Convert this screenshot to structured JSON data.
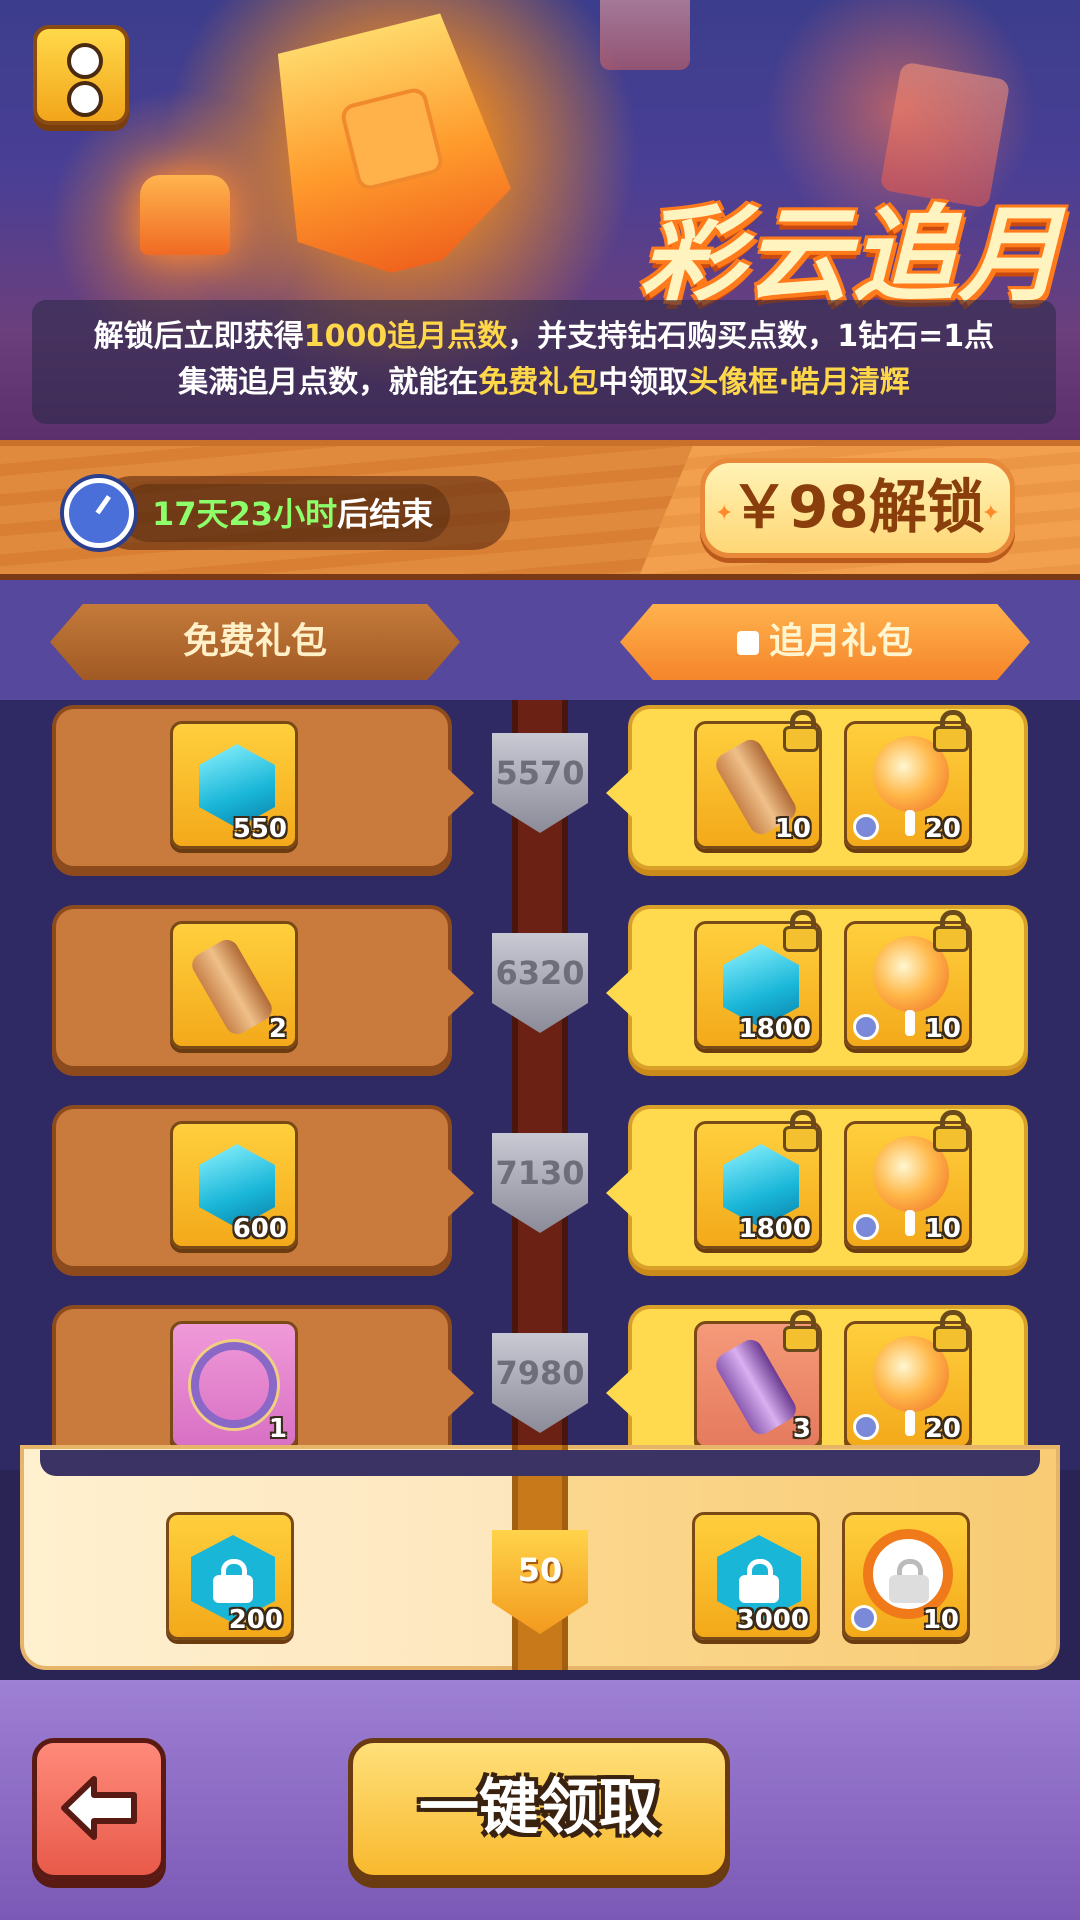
{
  "event": {
    "title": "彩云追月",
    "desc_line1": {
      "a": "解锁后立即获得",
      "b": "1000追月点数",
      "c": "，并支持钻石购买点数，1钻石=1点"
    },
    "desc_line2": {
      "a": "集满追月点数，就能在",
      "b": "免费礼包",
      "c": "中领取",
      "d": "头像框·皓月清辉"
    }
  },
  "timer": {
    "remaining": "17天23小时",
    "suffix": "后结束"
  },
  "unlock_button": {
    "label": "￥98解锁"
  },
  "tabs": {
    "free": "免费礼包",
    "premium": "追月礼包"
  },
  "rows": [
    {
      "points": "5570",
      "free": {
        "item": "gem-icon",
        "qty": "550"
      },
      "paid": [
        {
          "item": "scroll-icon",
          "qty": "10"
        },
        {
          "item": "lantern-icon",
          "qty": "20"
        }
      ]
    },
    {
      "points": "6320",
      "free": {
        "item": "scroll-icon",
        "qty": "2"
      },
      "paid": [
        {
          "item": "gem-icon",
          "qty": "1800"
        },
        {
          "item": "lantern-icon",
          "qty": "10"
        }
      ]
    },
    {
      "points": "7130",
      "free": {
        "item": "gem-icon",
        "qty": "600"
      },
      "paid": [
        {
          "item": "gem-icon",
          "qty": "1800"
        },
        {
          "item": "lantern-icon",
          "qty": "10"
        }
      ]
    },
    {
      "points": "7980",
      "free": {
        "item": "avatar-frame-icon",
        "qty": "1"
      },
      "paid": [
        {
          "item": "purple-scroll-icon",
          "qty": "3"
        },
        {
          "item": "lantern-icon",
          "qty": "20"
        }
      ]
    }
  ],
  "preview": {
    "level": "50",
    "free": {
      "item": "locked-gem-icon",
      "qty": "200"
    },
    "paid": [
      {
        "item": "locked-gem-icon",
        "qty": "3000"
      },
      {
        "item": "locked-lantern-icon",
        "qty": "10"
      }
    ]
  },
  "footer": {
    "claim_all_label": "一键领取"
  },
  "colors": {
    "highlight": "#ffd84a",
    "timer_green": "#8cff6a",
    "accent_orange": "#f5852a"
  }
}
